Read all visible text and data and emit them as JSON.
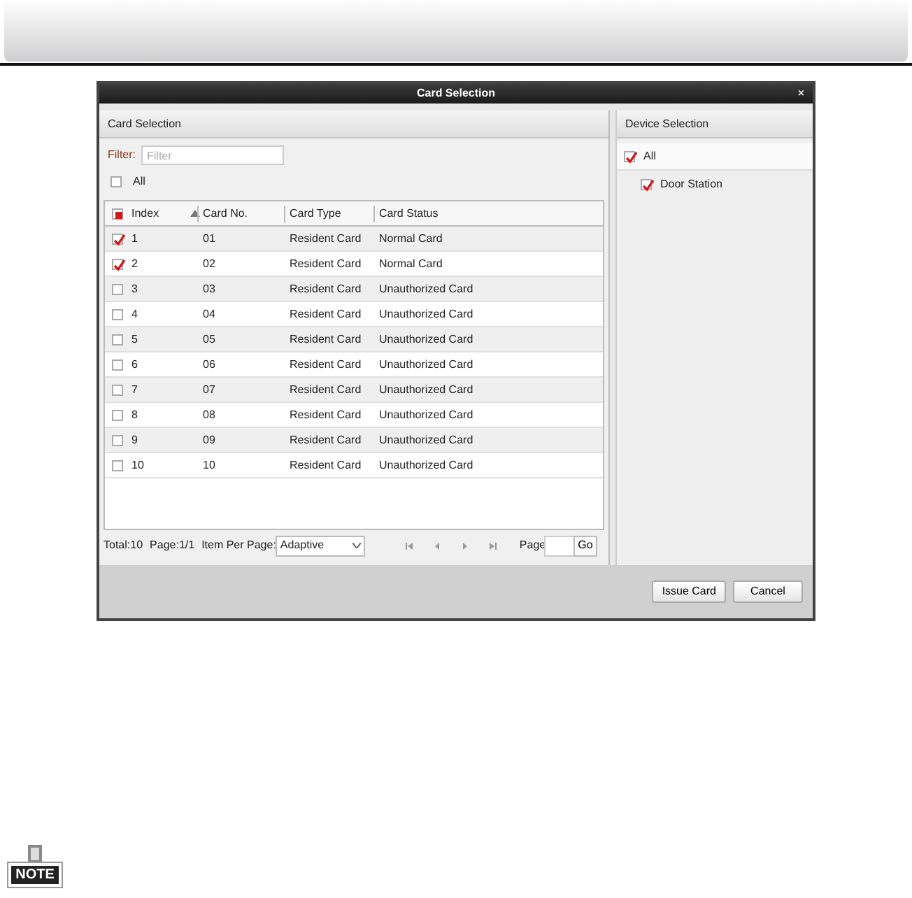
{
  "dialog": {
    "title": "Card Selection",
    "close": "×"
  },
  "card_selection": {
    "header": "Card Selection",
    "filter_label": "Filter:",
    "filter_placeholder": "Filter",
    "all_label": "All",
    "all_checked": false,
    "columns": [
      {
        "label": "Index",
        "sorted": true
      },
      {
        "label": "Card No.",
        "sorted": false
      },
      {
        "label": "Card Type",
        "sorted": false
      },
      {
        "label": "Card Status",
        "sorted": false
      }
    ],
    "header_checkbox_partial": true,
    "rows": [
      {
        "index": "1",
        "card_no": "01",
        "card_type": "Resident Card",
        "card_status": "Normal Card",
        "checked": true
      },
      {
        "index": "2",
        "card_no": "02",
        "card_type": "Resident Card",
        "card_status": "Normal Card",
        "checked": true
      },
      {
        "index": "3",
        "card_no": "03",
        "card_type": "Resident Card",
        "card_status": "Unauthorized Card",
        "checked": false
      },
      {
        "index": "4",
        "card_no": "04",
        "card_type": "Resident Card",
        "card_status": "Unauthorized Card",
        "checked": false
      },
      {
        "index": "5",
        "card_no": "05",
        "card_type": "Resident Card",
        "card_status": "Unauthorized Card",
        "checked": false
      },
      {
        "index": "6",
        "card_no": "06",
        "card_type": "Resident Card",
        "card_status": "Unauthorized Card",
        "checked": false
      },
      {
        "index": "7",
        "card_no": "07",
        "card_type": "Resident Card",
        "card_status": "Unauthorized Card",
        "checked": false
      },
      {
        "index": "8",
        "card_no": "08",
        "card_type": "Resident Card",
        "card_status": "Unauthorized Card",
        "checked": false
      },
      {
        "index": "9",
        "card_no": "09",
        "card_type": "Resident Card",
        "card_status": "Unauthorized Card",
        "checked": false
      },
      {
        "index": "10",
        "card_no": "10",
        "card_type": "Resident Card",
        "card_status": "Unauthorized Card",
        "checked": false
      }
    ],
    "footer": {
      "total": "Total:10",
      "page": "Page:1/1",
      "per_page_label": "Item Per Page:",
      "per_page_value": "Adaptive",
      "page_label": "Page",
      "go": "Go"
    }
  },
  "device_selection": {
    "header": "Device Selection",
    "tree": [
      {
        "label": "All",
        "checked": true,
        "children": [
          {
            "label": "Door Station",
            "checked": true
          }
        ]
      }
    ]
  },
  "buttons": [
    "Issue Card",
    "Cancel"
  ],
  "note": {
    "label": "NOTE"
  }
}
